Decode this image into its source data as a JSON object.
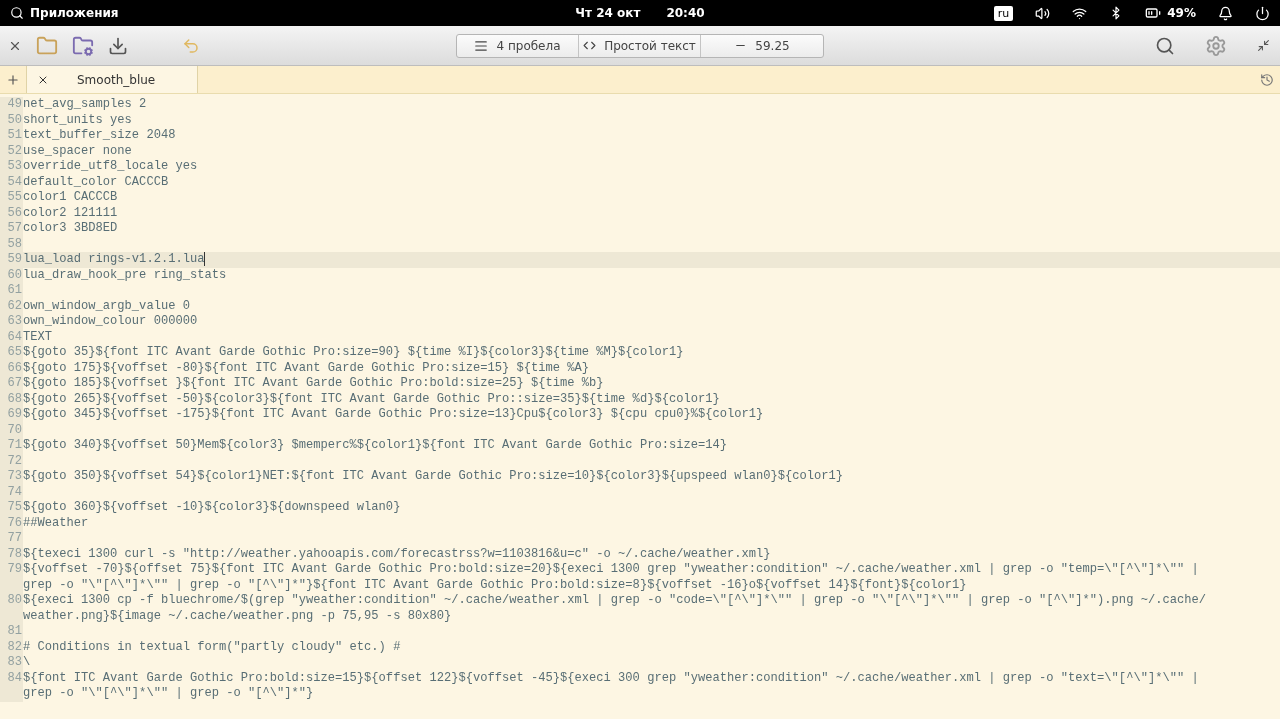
{
  "top_panel": {
    "apps_label": "Приложения",
    "date": "Чт 24 окт",
    "time": "20:40",
    "keyboard_layout": "ru",
    "battery": "49%"
  },
  "toolbar": {
    "indent": "4 пробела",
    "language": "Простой текст",
    "zoom": "59.25"
  },
  "tabs": [
    {
      "title": "Smooth_blue",
      "selected": true
    }
  ],
  "editor": {
    "lines": [
      {
        "number": "49",
        "rows": [
          "net_avg_samples 2"
        ],
        "current": false
      },
      {
        "number": "50",
        "rows": [
          "short_units yes"
        ],
        "current": false
      },
      {
        "number": "51",
        "rows": [
          "text_buffer_size 2048"
        ],
        "current": false
      },
      {
        "number": "52",
        "rows": [
          "use_spacer none"
        ],
        "current": false
      },
      {
        "number": "53",
        "rows": [
          "override_utf8_locale yes"
        ],
        "current": false
      },
      {
        "number": "54",
        "rows": [
          "default_color CACCCB"
        ],
        "current": false
      },
      {
        "number": "55",
        "rows": [
          "color1 CACCCB"
        ],
        "current": false
      },
      {
        "number": "56",
        "rows": [
          "color2 121111"
        ],
        "current": false
      },
      {
        "number": "57",
        "rows": [
          "color3 3BD8ED"
        ],
        "current": false
      },
      {
        "number": "58",
        "rows": [
          ""
        ],
        "current": false
      },
      {
        "number": "59",
        "rows": [
          "lua_load rings-v1.2.1.lua"
        ],
        "current": true
      },
      {
        "number": "60",
        "rows": [
          "lua_draw_hook_pre ring_stats"
        ],
        "current": false
      },
      {
        "number": "61",
        "rows": [
          ""
        ],
        "current": false
      },
      {
        "number": "62",
        "rows": [
          "own_window_argb_value 0"
        ],
        "current": false
      },
      {
        "number": "63",
        "rows": [
          "own_window_colour 000000"
        ],
        "current": false
      },
      {
        "number": "64",
        "rows": [
          "TEXT"
        ],
        "current": false
      },
      {
        "number": "65",
        "rows": [
          "${goto 35}${font ITC Avant Garde Gothic Pro:size=90} ${time %I}${color3}${time %M}${color1}"
        ],
        "current": false
      },
      {
        "number": "66",
        "rows": [
          "${goto 175}${voffset -80}${font ITC Avant Garde Gothic Pro:size=15} ${time %A}"
        ],
        "current": false
      },
      {
        "number": "67",
        "rows": [
          "${goto 185}${voffset }${font ITC Avant Garde Gothic Pro:bold:size=25} ${time %b}"
        ],
        "current": false
      },
      {
        "number": "68",
        "rows": [
          "${goto 265}${voffset -50}${color3}${font ITC Avant Garde Gothic Pro::size=35}${time %d}${color1}"
        ],
        "current": false
      },
      {
        "number": "69",
        "rows": [
          "${goto 345}${voffset -175}${font ITC Avant Garde Gothic Pro:size=13}Cpu${color3} ${cpu cpu0}%${color1}"
        ],
        "current": false
      },
      {
        "number": "70",
        "rows": [
          ""
        ],
        "current": false
      },
      {
        "number": "71",
        "rows": [
          "${goto 340}${voffset 50}Mem${color3} $memperc%${color1}${font ITC Avant Garde Gothic Pro:size=14}"
        ],
        "current": false
      },
      {
        "number": "72",
        "rows": [
          ""
        ],
        "current": false
      },
      {
        "number": "73",
        "rows": [
          "${goto 350}${voffset 54}${color1}NET:${font ITC Avant Garde Gothic Pro:size=10}${color3}${upspeed wlan0}${color1}"
        ],
        "current": false
      },
      {
        "number": "74",
        "rows": [
          ""
        ],
        "current": false
      },
      {
        "number": "75",
        "rows": [
          "${goto 360}${voffset -10}${color3}${downspeed wlan0}"
        ],
        "current": false
      },
      {
        "number": "76",
        "rows": [
          "##Weather"
        ],
        "current": false
      },
      {
        "number": "77",
        "rows": [
          ""
        ],
        "current": false
      },
      {
        "number": "78",
        "rows": [
          "${texeci 1300 curl -s \"http://weather.yahooapis.com/forecastrss?w=1103816&u=c\" -o ~/.cache/weather.xml}"
        ],
        "current": false
      },
      {
        "number": "79",
        "rows": [
          "${voffset -70}${offset 75}${font ITC Avant Garde Gothic Pro:bold:size=20}${execi 1300 grep \"yweather:condition\" ~/.cache/weather.xml | grep -o \"temp=\\\"[^\\\"]*\\\"\" |",
          "grep -o \"\\\"[^\\\"]*\\\"\" | grep -o \"[^\\\"]*\"}${font ITC Avant Garde Gothic Pro:bold:size=8}${voffset -16}o${voffset 14}${font}${color1}"
        ],
        "current": false
      },
      {
        "number": "80",
        "rows": [
          "${execi 1300 cp -f bluechrome/$(grep \"yweather:condition\" ~/.cache/weather.xml | grep -o \"code=\\\"[^\\\"]*\\\"\" | grep -o \"\\\"[^\\\"]*\\\"\" | grep -o \"[^\\\"]*\").png ~/.cache/",
          "weather.png}${image ~/.cache/weather.png -p 75,95 -s 80x80}"
        ],
        "current": false
      },
      {
        "number": "81",
        "rows": [
          ""
        ],
        "current": false
      },
      {
        "number": "82",
        "rows": [
          "# Conditions in textual form(\"partly cloudy\" etc.) #"
        ],
        "current": false
      },
      {
        "number": "83",
        "rows": [
          "\\"
        ],
        "current": false
      },
      {
        "number": "84",
        "rows": [
          "${font ITC Avant Garde Gothic Pro:bold:size=15}${offset 122}${voffset -45}${execi 300 grep \"yweather:condition\" ~/.cache/weather.xml | grep -o \"text=\\\"[^\\\"]*\\\"\" |",
          "grep -o \"\\\"[^\\\"]*\\\"\" | grep -o \"[^\\\"]*\"}"
        ],
        "current": false
      }
    ]
  }
}
